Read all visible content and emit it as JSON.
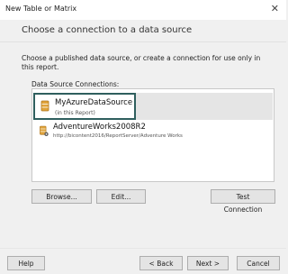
{
  "window": {
    "title": "New Table or Matrix",
    "close_glyph": "✕"
  },
  "page": {
    "heading": "Choose a connection to a data source",
    "description": "Choose a published data source, or create a connection for use only in this report."
  },
  "connections": {
    "label": "Data Source Connections:",
    "items": [
      {
        "name": "MyAzureDataSource",
        "subtitle": "(in this Report)",
        "icon": "database-icon",
        "selected": true
      },
      {
        "name": "AdventureWorks2008R2",
        "subtitle": "http://bicontent2016/ReportServer/Adventure Works",
        "icon": "shared-database-icon",
        "selected": false
      }
    ]
  },
  "buttons": {
    "browse": "Browse...",
    "edit": "Edit...",
    "test_connection": "Test Connection",
    "help": "Help",
    "back": "< Back",
    "next": "Next >",
    "cancel": "Cancel"
  },
  "colors": {
    "highlight_border": "#2f5f5e",
    "selected_bg": "#e5e5e5",
    "icon": "#e0a33a"
  }
}
